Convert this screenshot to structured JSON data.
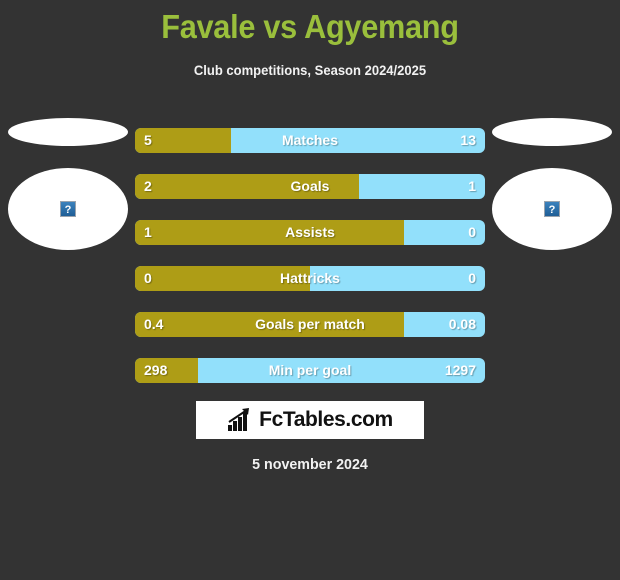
{
  "header": {
    "title": "Favale vs Agyemang",
    "subtitle": "Club competitions, Season 2024/2025",
    "title_color": "#9ABF3C"
  },
  "colors": {
    "background": "#333333",
    "home_bar": "#AE9D16",
    "away_bar": "#92E0FB",
    "text": "#ffffff"
  },
  "players": {
    "home": {
      "name": "",
      "avatar_icon": "broken-image-icon",
      "avatar_alt": "?"
    },
    "away": {
      "name": "",
      "avatar_icon": "broken-image-icon",
      "avatar_alt": "?"
    }
  },
  "stats": [
    {
      "label": "Matches",
      "home": "5",
      "away": "13",
      "home_pct": 27.5
    },
    {
      "label": "Goals",
      "home": "2",
      "away": "1",
      "home_pct": 64.0
    },
    {
      "label": "Assists",
      "home": "1",
      "away": "0",
      "home_pct": 76.8
    },
    {
      "label": "Hattricks",
      "home": "0",
      "away": "0",
      "home_pct": 50.0
    },
    {
      "label": "Goals per match",
      "home": "0.4",
      "away": "0.08",
      "home_pct": 76.8
    },
    {
      "label": "Min per goal",
      "home": "298",
      "away": "1297",
      "home_pct": 18.0
    }
  ],
  "footer": {
    "logo_text": "FcTables.com",
    "logo_icon": "bar-chart-arrow-icon",
    "date": "5 november 2024"
  }
}
